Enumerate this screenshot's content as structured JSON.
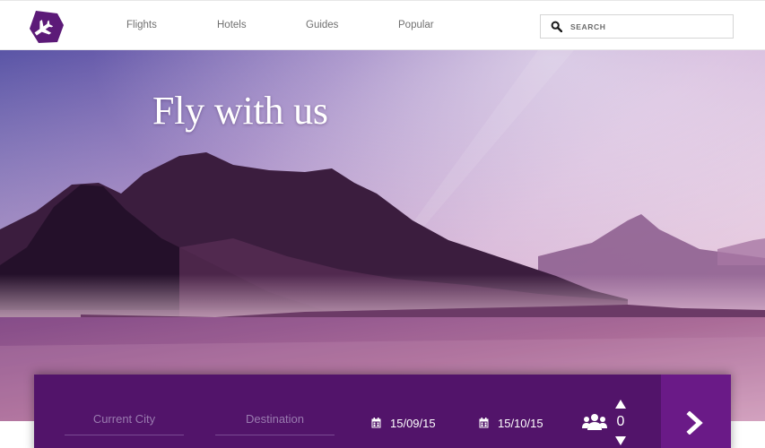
{
  "header": {
    "nav": [
      {
        "label": "Flights"
      },
      {
        "label": "Hotels"
      },
      {
        "label": "Guides"
      },
      {
        "label": "Popular"
      }
    ],
    "search": {
      "placeholder": "SEARCH",
      "icon": "search-icon"
    },
    "logo_icon": "plane-logo-icon"
  },
  "hero": {
    "title": "Fly with us"
  },
  "booking": {
    "from_placeholder": "Current City",
    "to_placeholder": "Destination",
    "depart_date": "15/09/15",
    "return_date": "15/10/15",
    "guests_count": "0",
    "submit_icon": "chevron-right-icon"
  },
  "colors": {
    "brand": "#52146a",
    "brand_light": "#6a1a87",
    "nav_text": "#707070"
  }
}
